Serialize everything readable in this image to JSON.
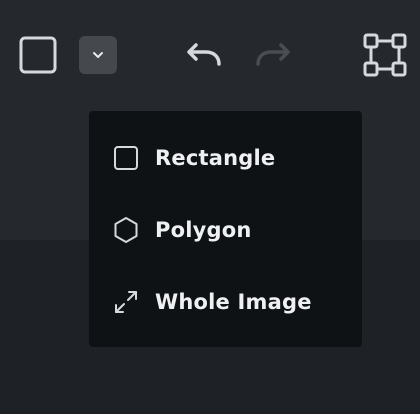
{
  "toolbar": {
    "shape_tool": {
      "icon": "square-icon"
    },
    "dropdown": {
      "icon": "chevron-down-icon"
    },
    "undo": {
      "icon": "undo-icon",
      "enabled": true
    },
    "redo": {
      "icon": "redo-icon",
      "enabled": false
    },
    "selection": {
      "icon": "bounding-box-icon"
    }
  },
  "menu": {
    "items": [
      {
        "label": "Rectangle",
        "icon": "square-icon"
      },
      {
        "label": "Polygon",
        "icon": "hexagon-icon"
      },
      {
        "label": "Whole Image",
        "icon": "expand-arrows-icon"
      }
    ]
  },
  "colors": {
    "toolbar_bg": "#25282c",
    "menu_bg": "#0f1215",
    "icon": "#d5d8dc",
    "icon_disabled": "#4a4e53",
    "text": "#eef0f2"
  }
}
